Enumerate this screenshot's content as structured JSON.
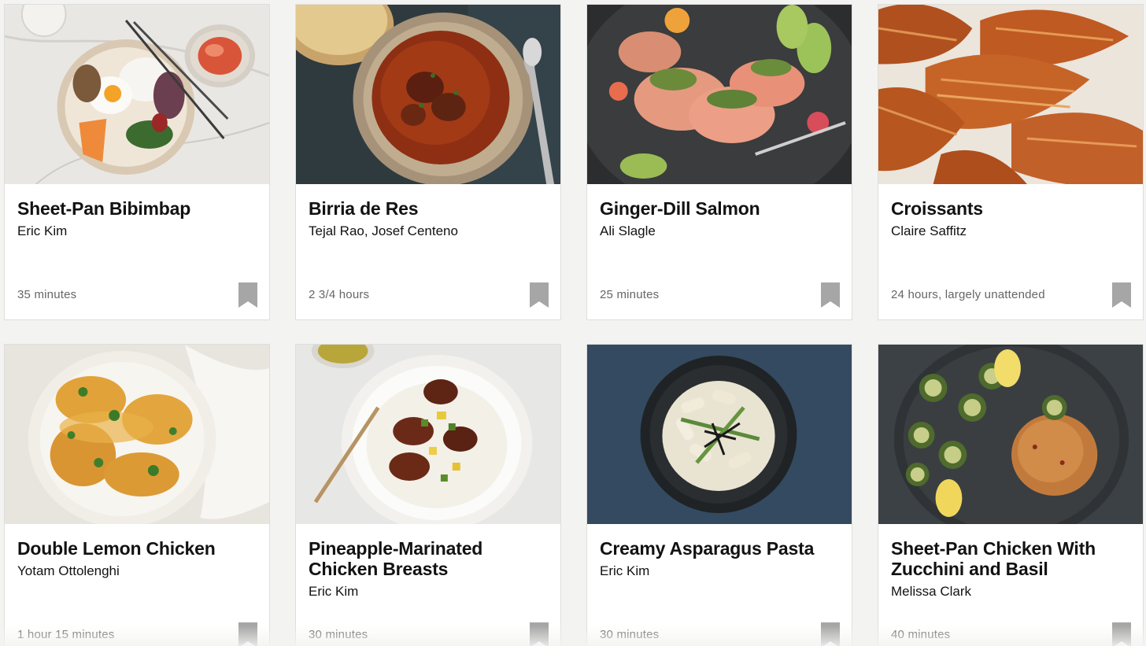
{
  "recipes": [
    {
      "title": "Sheet-Pan Bibimbap",
      "author": "Eric Kim",
      "time": "35 minutes"
    },
    {
      "title": "Birria de Res",
      "author": "Tejal Rao, Josef Centeno",
      "time": "2 3/4 hours"
    },
    {
      "title": "Ginger-Dill Salmon",
      "author": "Ali Slagle",
      "time": "25 minutes"
    },
    {
      "title": "Croissants",
      "author": "Claire Saffitz",
      "time": "24 hours, largely unattended"
    },
    {
      "title": "Double Lemon Chicken",
      "author": "Yotam Ottolenghi",
      "time": "1 hour 15 minutes"
    },
    {
      "title": "Pineapple-Marinated Chicken Breasts",
      "author": "Eric Kim",
      "time": "30 minutes"
    },
    {
      "title": "Creamy Asparagus Pasta",
      "author": "Eric Kim",
      "time": "30 minutes"
    },
    {
      "title": "Sheet-Pan Chicken With Zucchini and Basil",
      "author": "Melissa Clark",
      "time": "40 minutes"
    }
  ],
  "icons": {
    "bookmark": "bookmark-icon"
  },
  "colors": {
    "page_background": "#f3f3f1",
    "card_background": "#ffffff",
    "title_text": "#121212",
    "time_text": "#666666",
    "bookmark": "#a6a6a6"
  }
}
